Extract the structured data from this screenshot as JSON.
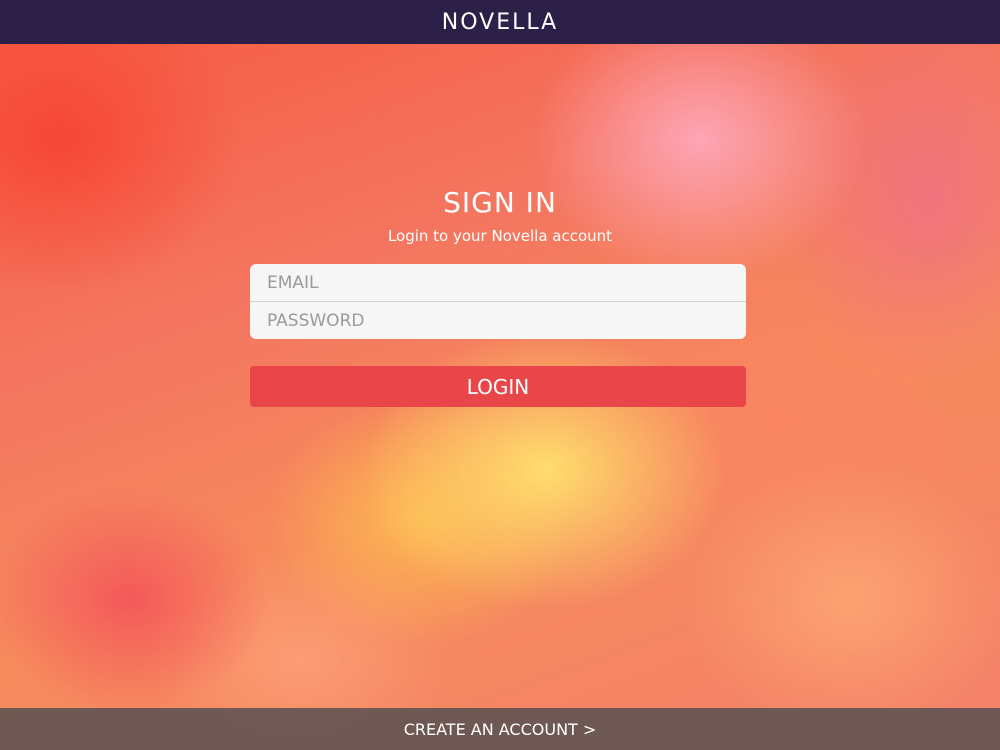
{
  "header": {
    "app_title": "NOVELLA"
  },
  "signin": {
    "title": "SIGN IN",
    "subtitle": "Login to your Novella account",
    "email_placeholder": "EMAIL",
    "email_value": "",
    "password_placeholder": "PASSWORD",
    "password_value": "",
    "login_label": "LOGIN"
  },
  "footer": {
    "create_account_label": "CREATE AN ACCOUNT >"
  },
  "colors": {
    "topbar": "#2d2048",
    "login_button": "#e84648",
    "field_background": "#f6f6f6"
  }
}
